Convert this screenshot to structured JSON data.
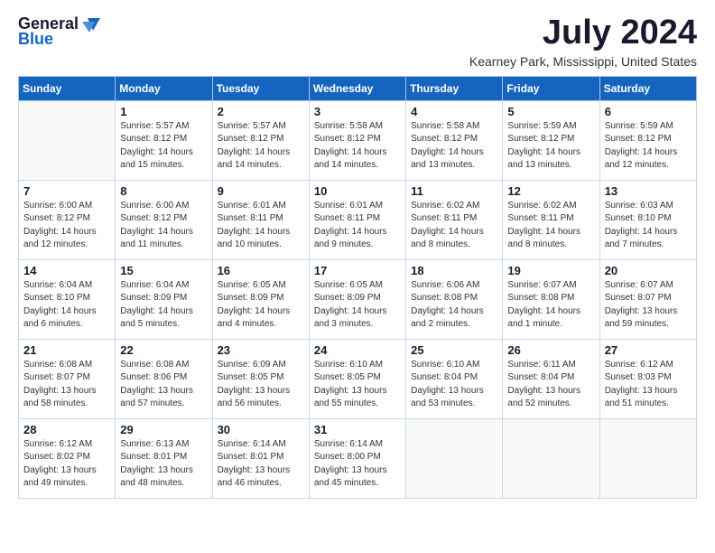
{
  "logo": {
    "general": "General",
    "blue": "Blue"
  },
  "title": "July 2024",
  "location": "Kearney Park, Mississippi, United States",
  "days_of_week": [
    "Sunday",
    "Monday",
    "Tuesday",
    "Wednesday",
    "Thursday",
    "Friday",
    "Saturday"
  ],
  "weeks": [
    [
      {
        "day": "",
        "sunrise": "",
        "sunset": "",
        "daylight": ""
      },
      {
        "day": "1",
        "sunrise": "Sunrise: 5:57 AM",
        "sunset": "Sunset: 8:12 PM",
        "daylight": "Daylight: 14 hours and 15 minutes."
      },
      {
        "day": "2",
        "sunrise": "Sunrise: 5:57 AM",
        "sunset": "Sunset: 8:12 PM",
        "daylight": "Daylight: 14 hours and 14 minutes."
      },
      {
        "day": "3",
        "sunrise": "Sunrise: 5:58 AM",
        "sunset": "Sunset: 8:12 PM",
        "daylight": "Daylight: 14 hours and 14 minutes."
      },
      {
        "day": "4",
        "sunrise": "Sunrise: 5:58 AM",
        "sunset": "Sunset: 8:12 PM",
        "daylight": "Daylight: 14 hours and 13 minutes."
      },
      {
        "day": "5",
        "sunrise": "Sunrise: 5:59 AM",
        "sunset": "Sunset: 8:12 PM",
        "daylight": "Daylight: 14 hours and 13 minutes."
      },
      {
        "day": "6",
        "sunrise": "Sunrise: 5:59 AM",
        "sunset": "Sunset: 8:12 PM",
        "daylight": "Daylight: 14 hours and 12 minutes."
      }
    ],
    [
      {
        "day": "7",
        "sunrise": "Sunrise: 6:00 AM",
        "sunset": "Sunset: 8:12 PM",
        "daylight": "Daylight: 14 hours and 12 minutes."
      },
      {
        "day": "8",
        "sunrise": "Sunrise: 6:00 AM",
        "sunset": "Sunset: 8:12 PM",
        "daylight": "Daylight: 14 hours and 11 minutes."
      },
      {
        "day": "9",
        "sunrise": "Sunrise: 6:01 AM",
        "sunset": "Sunset: 8:11 PM",
        "daylight": "Daylight: 14 hours and 10 minutes."
      },
      {
        "day": "10",
        "sunrise": "Sunrise: 6:01 AM",
        "sunset": "Sunset: 8:11 PM",
        "daylight": "Daylight: 14 hours and 9 minutes."
      },
      {
        "day": "11",
        "sunrise": "Sunrise: 6:02 AM",
        "sunset": "Sunset: 8:11 PM",
        "daylight": "Daylight: 14 hours and 8 minutes."
      },
      {
        "day": "12",
        "sunrise": "Sunrise: 6:02 AM",
        "sunset": "Sunset: 8:11 PM",
        "daylight": "Daylight: 14 hours and 8 minutes."
      },
      {
        "day": "13",
        "sunrise": "Sunrise: 6:03 AM",
        "sunset": "Sunset: 8:10 PM",
        "daylight": "Daylight: 14 hours and 7 minutes."
      }
    ],
    [
      {
        "day": "14",
        "sunrise": "Sunrise: 6:04 AM",
        "sunset": "Sunset: 8:10 PM",
        "daylight": "Daylight: 14 hours and 6 minutes."
      },
      {
        "day": "15",
        "sunrise": "Sunrise: 6:04 AM",
        "sunset": "Sunset: 8:09 PM",
        "daylight": "Daylight: 14 hours and 5 minutes."
      },
      {
        "day": "16",
        "sunrise": "Sunrise: 6:05 AM",
        "sunset": "Sunset: 8:09 PM",
        "daylight": "Daylight: 14 hours and 4 minutes."
      },
      {
        "day": "17",
        "sunrise": "Sunrise: 6:05 AM",
        "sunset": "Sunset: 8:09 PM",
        "daylight": "Daylight: 14 hours and 3 minutes."
      },
      {
        "day": "18",
        "sunrise": "Sunrise: 6:06 AM",
        "sunset": "Sunset: 8:08 PM",
        "daylight": "Daylight: 14 hours and 2 minutes."
      },
      {
        "day": "19",
        "sunrise": "Sunrise: 6:07 AM",
        "sunset": "Sunset: 8:08 PM",
        "daylight": "Daylight: 14 hours and 1 minute."
      },
      {
        "day": "20",
        "sunrise": "Sunrise: 6:07 AM",
        "sunset": "Sunset: 8:07 PM",
        "daylight": "Daylight: 13 hours and 59 minutes."
      }
    ],
    [
      {
        "day": "21",
        "sunrise": "Sunrise: 6:08 AM",
        "sunset": "Sunset: 8:07 PM",
        "daylight": "Daylight: 13 hours and 58 minutes."
      },
      {
        "day": "22",
        "sunrise": "Sunrise: 6:08 AM",
        "sunset": "Sunset: 8:06 PM",
        "daylight": "Daylight: 13 hours and 57 minutes."
      },
      {
        "day": "23",
        "sunrise": "Sunrise: 6:09 AM",
        "sunset": "Sunset: 8:05 PM",
        "daylight": "Daylight: 13 hours and 56 minutes."
      },
      {
        "day": "24",
        "sunrise": "Sunrise: 6:10 AM",
        "sunset": "Sunset: 8:05 PM",
        "daylight": "Daylight: 13 hours and 55 minutes."
      },
      {
        "day": "25",
        "sunrise": "Sunrise: 6:10 AM",
        "sunset": "Sunset: 8:04 PM",
        "daylight": "Daylight: 13 hours and 53 minutes."
      },
      {
        "day": "26",
        "sunrise": "Sunrise: 6:11 AM",
        "sunset": "Sunset: 8:04 PM",
        "daylight": "Daylight: 13 hours and 52 minutes."
      },
      {
        "day": "27",
        "sunrise": "Sunrise: 6:12 AM",
        "sunset": "Sunset: 8:03 PM",
        "daylight": "Daylight: 13 hours and 51 minutes."
      }
    ],
    [
      {
        "day": "28",
        "sunrise": "Sunrise: 6:12 AM",
        "sunset": "Sunset: 8:02 PM",
        "daylight": "Daylight: 13 hours and 49 minutes."
      },
      {
        "day": "29",
        "sunrise": "Sunrise: 6:13 AM",
        "sunset": "Sunset: 8:01 PM",
        "daylight": "Daylight: 13 hours and 48 minutes."
      },
      {
        "day": "30",
        "sunrise": "Sunrise: 6:14 AM",
        "sunset": "Sunset: 8:01 PM",
        "daylight": "Daylight: 13 hours and 46 minutes."
      },
      {
        "day": "31",
        "sunrise": "Sunrise: 6:14 AM",
        "sunset": "Sunset: 8:00 PM",
        "daylight": "Daylight: 13 hours and 45 minutes."
      },
      {
        "day": "",
        "sunrise": "",
        "sunset": "",
        "daylight": ""
      },
      {
        "day": "",
        "sunrise": "",
        "sunset": "",
        "daylight": ""
      },
      {
        "day": "",
        "sunrise": "",
        "sunset": "",
        "daylight": ""
      }
    ]
  ]
}
